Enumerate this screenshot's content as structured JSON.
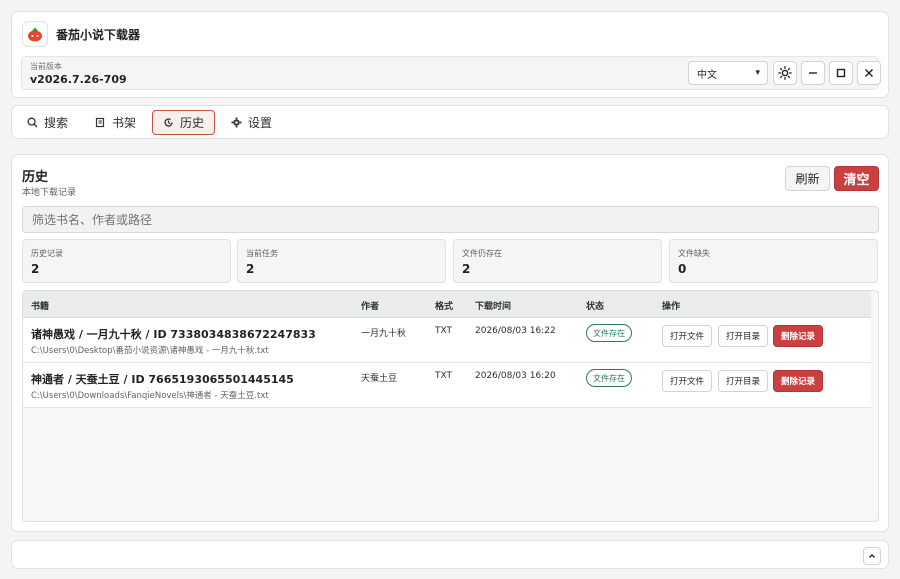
{
  "app": {
    "title": "番茄小说下载器",
    "logo_icon": "tomato-icon"
  },
  "version": {
    "label": "当前版本",
    "value": "v2026.7.26-709"
  },
  "controls": {
    "language": "中文"
  },
  "tabs": [
    {
      "label": "搜索",
      "icon": "search-icon"
    },
    {
      "label": "书架",
      "icon": "bookshelf-icon"
    },
    {
      "label": "历史",
      "icon": "history-icon",
      "active": true
    },
    {
      "label": "设置",
      "icon": "gear-icon"
    }
  ],
  "history": {
    "title": "历史",
    "subtitle": "本地下载记录",
    "refresh_label": "刷新",
    "clear_label": "清空",
    "filter_placeholder": "筛选书名、作者或路径",
    "stats": [
      {
        "label": "历史记录",
        "value": "2"
      },
      {
        "label": "当前任务",
        "value": "2"
      },
      {
        "label": "文件仍存在",
        "value": "2"
      },
      {
        "label": "文件缺失",
        "value": "0"
      }
    ],
    "columns": [
      "书籍",
      "作者",
      "格式",
      "下载时间",
      "状态",
      "操作"
    ],
    "rows": [
      {
        "title": "诸神愚戏 / 一月九十秋 / ID 7338034838672247833",
        "path": "C:\\Users\\0\\Desktop\\番茄小说资源\\诸神愚戏 - 一月九十秋.txt",
        "author": "一月九十秋",
        "format": "TXT",
        "time": "2026/08/03 16:22",
        "status": "文件存在",
        "open_file": "打开文件",
        "open_dir": "打开目录",
        "delete": "删除记录"
      },
      {
        "title": "神通者 / 天蚕土豆 / ID 7665193065501445145",
        "path": "C:\\Users\\0\\Downloads\\FanqieNovels\\神通者 - 天蚕土豆.txt",
        "author": "天蚕土豆",
        "format": "TXT",
        "time": "2026/08/03 16:20",
        "status": "文件存在",
        "open_file": "打开文件",
        "open_dir": "打开目录",
        "delete": "删除记录"
      }
    ]
  },
  "colors": {
    "accent": "#c94040",
    "success": "#2f7a5a",
    "tab_active_border": "#c9503a"
  }
}
